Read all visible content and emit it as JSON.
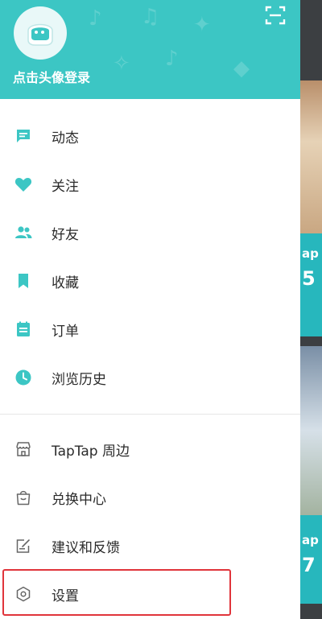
{
  "header": {
    "login_label": "点击头像登录",
    "bg_color": "#3cc6c4"
  },
  "menu_primary": [
    {
      "label": "动态",
      "icon": "chat-bubble-icon"
    },
    {
      "label": "关注",
      "icon": "heart-icon"
    },
    {
      "label": "好友",
      "icon": "friends-icon"
    },
    {
      "label": "收藏",
      "icon": "bookmark-icon"
    },
    {
      "label": "订单",
      "icon": "order-clipboard-icon"
    },
    {
      "label": "浏览历史",
      "icon": "clock-icon"
    }
  ],
  "menu_secondary": [
    {
      "label": "TapTap 周边",
      "icon": "store-icon"
    },
    {
      "label": "兑换中心",
      "icon": "shopping-bag-icon"
    },
    {
      "label": "建议和反馈",
      "icon": "feedback-edit-icon"
    },
    {
      "label": "设置",
      "icon": "settings-hexagon-icon"
    }
  ],
  "background": {
    "card2_text_top": "ap",
    "card2_text_bottom": "5",
    "card4_text_top": "ap",
    "card4_text_bottom": "7"
  },
  "colors": {
    "accent": "#3cc6c4",
    "highlight": "#e0343b"
  }
}
